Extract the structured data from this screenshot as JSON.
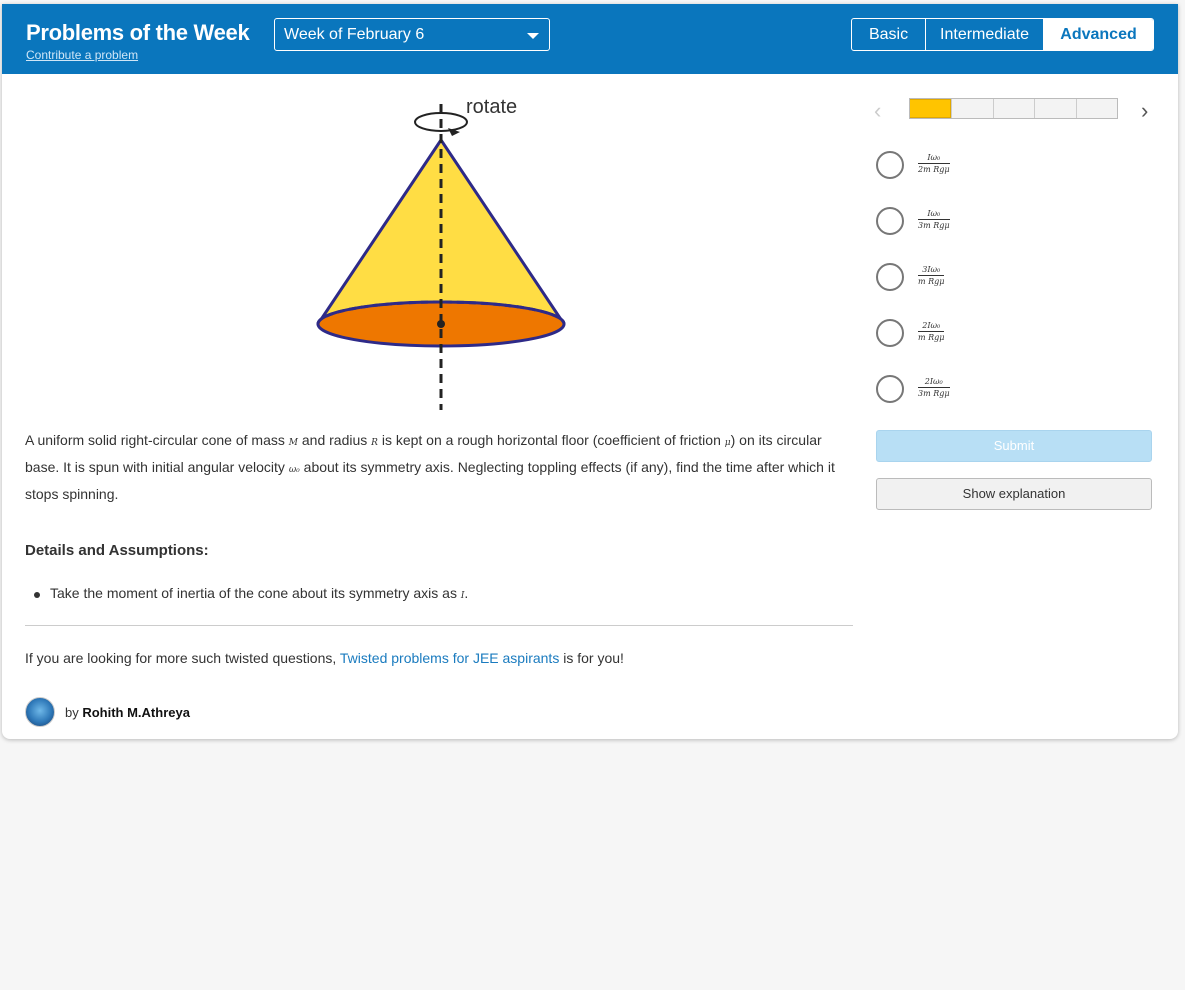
{
  "header": {
    "title": "Problems of the Week",
    "contribute_link": "Contribute a problem",
    "week_select": "Week of February 6",
    "levels": [
      "Basic",
      "Intermediate",
      "Advanced"
    ],
    "active_level": "Advanced"
  },
  "figure": {
    "rotate_label": "rotate",
    "colors": {
      "cone": "#ffdd44",
      "base": "#ee7700",
      "outline": "#2e2a88"
    }
  },
  "problem": {
    "part1": "A uniform solid right-circular cone of mass ",
    "var_M": "M",
    "part2": " and radius ",
    "var_R": "R",
    "part3": " is kept on a rough horizontal floor (coefficient of friction ",
    "var_mu": "μ",
    "part4": ") on its circular base. It is spun with initial angular velocity ",
    "var_w0": "ω₀",
    "part5": " about its symmetry axis. Neglecting toppling effects (if any), find the time after which it stops spinning."
  },
  "details": {
    "heading": "Details and Assumptions:",
    "item_text": "Take the moment of inertia of the cone about its symmetry axis as ",
    "item_var": "I",
    "item_end": "."
  },
  "promo": {
    "before": "If you are looking for more such twisted questions, ",
    "link": "Twisted problems for JEE aspirants",
    "after": " is for you!"
  },
  "author": {
    "by": "by ",
    "name": "Rohith M.Athreya"
  },
  "progress": {
    "total": 5,
    "completed": 1
  },
  "options": [
    {
      "num": "Iω₀",
      "den": "2m Rgμ"
    },
    {
      "num": "Iω₀",
      "den": "3m Rgμ"
    },
    {
      "num": "3Iω₀",
      "den": "m Rgμ"
    },
    {
      "num": "2Iω₀",
      "den": "m Rgμ"
    },
    {
      "num": "2Iω₀",
      "den": "3m Rgμ"
    }
  ],
  "buttons": {
    "submit": "Submit",
    "explanation": "Show explanation"
  }
}
